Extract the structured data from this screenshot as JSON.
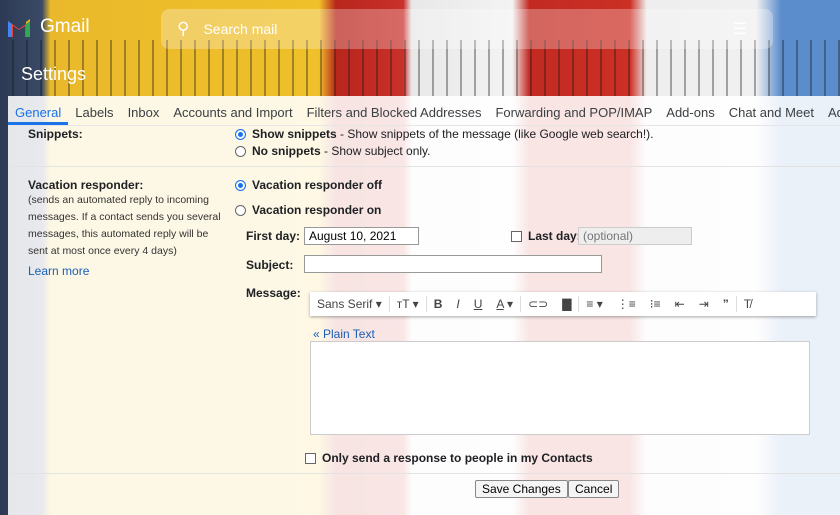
{
  "header": {
    "app_name": "Gmail",
    "search_placeholder": "Search mail",
    "page_title": "Settings"
  },
  "tabs": [
    "General",
    "Labels",
    "Inbox",
    "Accounts and Import",
    "Filters and Blocked Addresses",
    "Forwarding and POP/IMAP",
    "Add-ons",
    "Chat and Meet",
    "Advanced"
  ],
  "snippets": {
    "label": "Snippets:",
    "show": "Show snippets",
    "show_desc": " - Show snippets of the message (like Google web search!).",
    "none": "No snippets",
    "none_desc": " - Show subject only.",
    "selected": "show"
  },
  "vacation": {
    "label": "Vacation responder:",
    "desc": "(sends an automated reply to incoming messages. If a contact sends you several messages, this automated reply will be sent at most once every 4 days)",
    "learn_more": "Learn more",
    "off": "Vacation responder off",
    "on": "Vacation responder on",
    "selected": "off",
    "first_day_label": "First day:",
    "first_day": "August 10, 2021",
    "last_day_label": "Last day:",
    "last_day_placeholder": "(optional)",
    "subject_label": "Subject:",
    "subject": "",
    "message_label": "Message:",
    "font": "Sans Serif",
    "plain_text": "« Plain Text",
    "contacts_only": "Only send a response to people in my Contacts"
  },
  "buttons": {
    "save": "Save Changes",
    "cancel": "Cancel"
  },
  "colors": {
    "accent": "#1a73e8"
  }
}
